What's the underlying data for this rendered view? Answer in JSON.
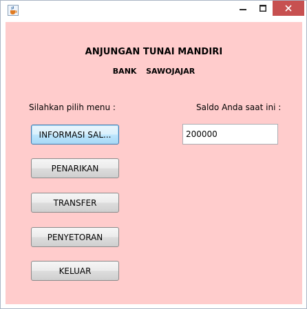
{
  "window": {
    "min_glyph": "—",
    "max_glyph": "☐",
    "close_glyph": "✕"
  },
  "header": {
    "title": "ANJUNGAN TUNAI MANDIRI",
    "subtitle": "BANK  SAWOJAJAR"
  },
  "labels": {
    "menu": "Silahkan pilih menu :",
    "saldo": "Saldo Anda saat ini :"
  },
  "buttons": {
    "informasi_saldo": "INFORMASI SAL...",
    "penarikan": "PENARIKAN",
    "transfer": "TRANSFER",
    "penyetoran": "PENYETORAN",
    "keluar": "KELUAR"
  },
  "saldo_field": {
    "value": "200000"
  },
  "colors": {
    "background": "#ffcccc",
    "close_button": "#c75050"
  },
  "icons": {
    "app": "java-cup-icon",
    "minimize": "minimize-icon",
    "maximize": "maximize-icon",
    "close": "close-icon"
  }
}
